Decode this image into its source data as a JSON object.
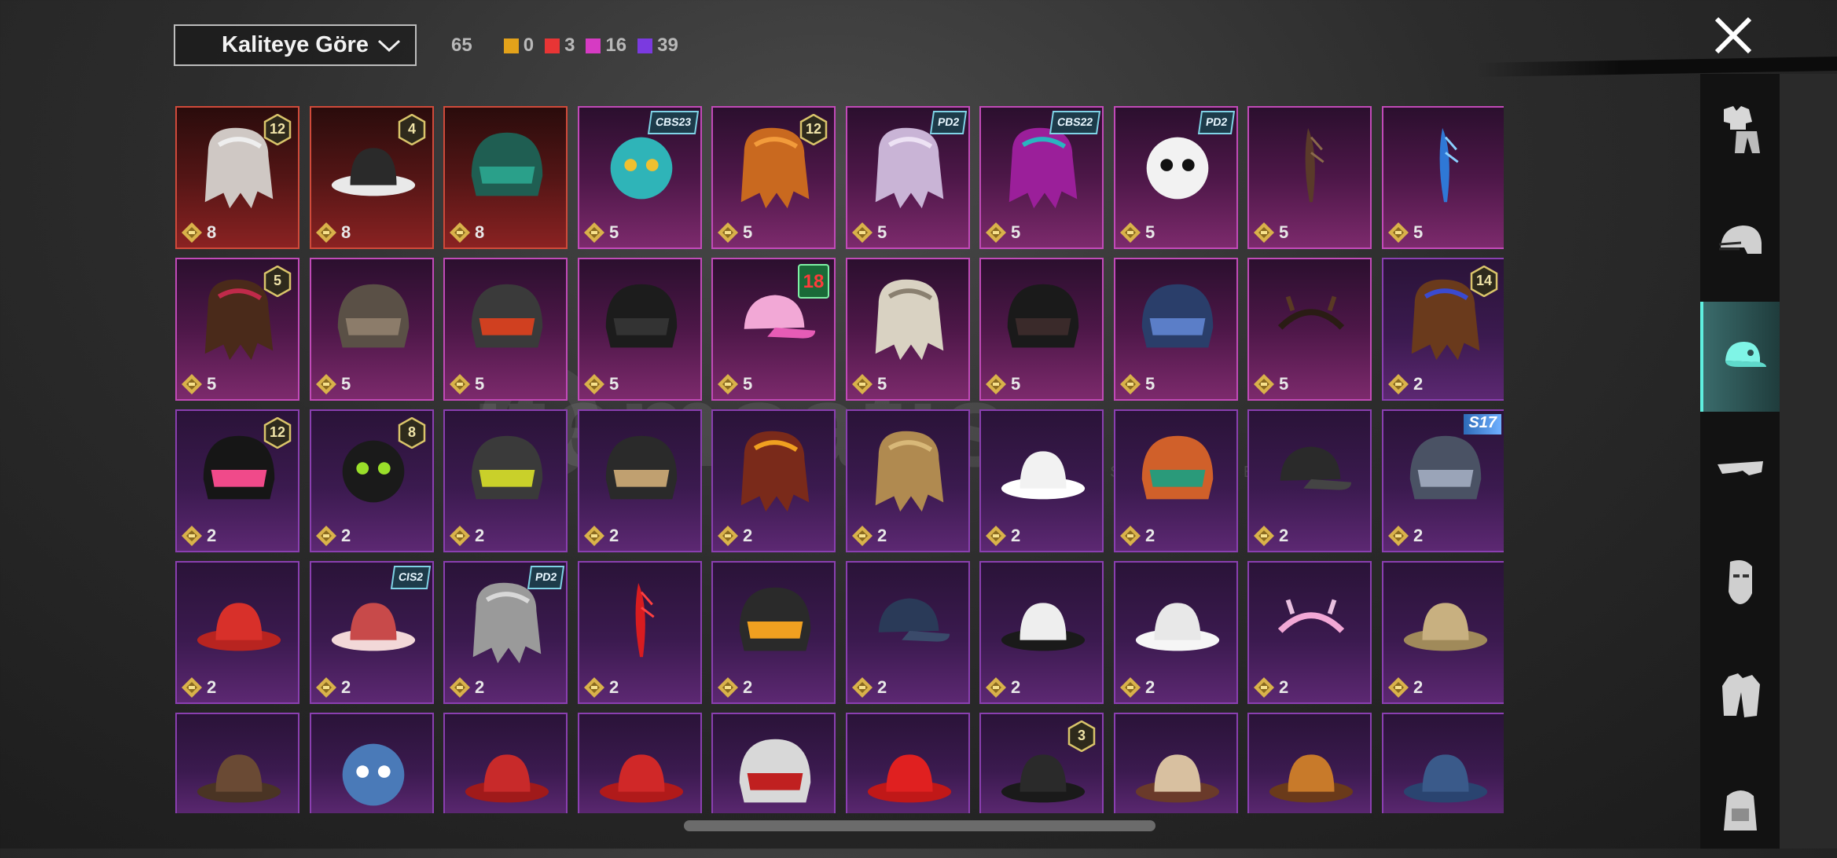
{
  "sort": {
    "label": "Kaliteye Göre"
  },
  "counts": {
    "total": "65",
    "items": [
      {
        "color": "#e3a21a",
        "value": "0"
      },
      {
        "color": "#e83535",
        "value": "3"
      },
      {
        "color": "#d63bc3",
        "value": "16"
      },
      {
        "color": "#7b3ae0",
        "value": "39"
      }
    ]
  },
  "watermark": {
    "text": "itemsatis",
    "sub": "/ SKIN / ITEM / E-PIN .com"
  },
  "categories": [
    {
      "icon": "outfit-icon"
    },
    {
      "icon": "helmet-icon"
    },
    {
      "icon": "cap-icon",
      "active": true
    },
    {
      "icon": "goggles-icon"
    },
    {
      "icon": "mask-icon"
    },
    {
      "icon": "jacket-icon"
    },
    {
      "icon": "backpack-icon"
    }
  ],
  "items": [
    {
      "rarity": "red",
      "price": "8",
      "badge": "12",
      "art": "white-wig"
    },
    {
      "rarity": "red",
      "price": "8",
      "badge": "4",
      "art": "snowman-tophat"
    },
    {
      "rarity": "red",
      "price": "8",
      "badge": "",
      "art": "dragon-helm"
    },
    {
      "rarity": "pink",
      "price": "5",
      "tag": "CBS23",
      "art": "cat-headphones"
    },
    {
      "rarity": "pink",
      "price": "5",
      "badge": "12",
      "art": "orange-hair"
    },
    {
      "rarity": "pink",
      "price": "5",
      "tag": "PD2",
      "art": "lilac-hair"
    },
    {
      "rarity": "pink",
      "price": "5",
      "tag": "CBS22",
      "art": "magenta-hair"
    },
    {
      "rarity": "pink",
      "price": "5",
      "tag": "PD2",
      "art": "panda-head"
    },
    {
      "rarity": "pink",
      "price": "5",
      "badge": "",
      "art": "feather"
    },
    {
      "rarity": "pink",
      "price": "5",
      "badge": "",
      "art": "blue-bird"
    },
    {
      "rarity": "pink",
      "price": "5",
      "badge": "5",
      "art": "bow-hair"
    },
    {
      "rarity": "pink",
      "price": "5",
      "badge": "",
      "art": "spiked-mask"
    },
    {
      "rarity": "pink",
      "price": "5",
      "badge": "",
      "art": "moto-helmet"
    },
    {
      "rarity": "pink",
      "price": "5",
      "badge": "",
      "art": "black-helmet"
    },
    {
      "rarity": "pink",
      "price": "5",
      "age": "18",
      "art": "pink-cap-headphones"
    },
    {
      "rarity": "pink",
      "price": "5",
      "badge": "",
      "art": "dreadlocks"
    },
    {
      "rarity": "pink",
      "price": "5",
      "badge": "",
      "art": "dark-hood"
    },
    {
      "rarity": "pink",
      "price": "5",
      "badge": "",
      "art": "blue-mech-helm"
    },
    {
      "rarity": "pink",
      "price": "5",
      "badge": "",
      "art": "headband"
    },
    {
      "rarity": "purple",
      "price": "2",
      "badge": "14",
      "art": "cat-hair"
    },
    {
      "rarity": "purple",
      "price": "2",
      "badge": "12",
      "art": "bunny-helmet"
    },
    {
      "rarity": "purple",
      "price": "2",
      "badge": "8",
      "art": "green-skull-hair"
    },
    {
      "rarity": "purple",
      "price": "2",
      "badge": "",
      "art": "gas-mask-helm"
    },
    {
      "rarity": "purple",
      "price": "2",
      "badge": "",
      "art": "visor-helmet"
    },
    {
      "rarity": "purple",
      "price": "2",
      "badge": "",
      "art": "goggles-hair"
    },
    {
      "rarity": "purple",
      "price": "2",
      "badge": "",
      "art": "blonde-hair"
    },
    {
      "rarity": "purple",
      "price": "2",
      "badge": "",
      "art": "sun-hat"
    },
    {
      "rarity": "purple",
      "price": "2",
      "badge": "",
      "art": "orange-helmet"
    },
    {
      "rarity": "purple",
      "price": "2",
      "badge": "",
      "art": "black-cap"
    },
    {
      "rarity": "purple",
      "price": "2",
      "season": "S17",
      "art": "horned-helm"
    },
    {
      "rarity": "purple",
      "price": "2",
      "badge": "",
      "art": "fez"
    },
    {
      "rarity": "purple",
      "price": "2",
      "tag": "CIS2",
      "art": "striped-beanie"
    },
    {
      "rarity": "purple",
      "price": "2",
      "tag": "PD2",
      "art": "grey-bob"
    },
    {
      "rarity": "purple",
      "price": "2",
      "badge": "",
      "art": "red-mohawk"
    },
    {
      "rarity": "purple",
      "price": "2",
      "badge": "",
      "art": "robot-mask"
    },
    {
      "rarity": "purple",
      "price": "2",
      "badge": "",
      "art": "navy-cap"
    },
    {
      "rarity": "purple",
      "price": "2",
      "badge": "",
      "art": "conical-hat"
    },
    {
      "rarity": "purple",
      "price": "2",
      "badge": "",
      "art": "white-beanie"
    },
    {
      "rarity": "purple",
      "price": "2",
      "badge": "",
      "art": "cat-ear-headphones"
    },
    {
      "rarity": "purple",
      "price": "2",
      "badge": "",
      "art": "straw-hat"
    },
    {
      "rarity": "purple",
      "price": "",
      "badge": "",
      "art": "cowboy-hat"
    },
    {
      "rarity": "purple",
      "price": "",
      "badge": "",
      "art": "shark-hat"
    },
    {
      "rarity": "purple",
      "price": "",
      "badge": "",
      "art": "red-beret"
    },
    {
      "rarity": "purple",
      "price": "",
      "badge": "",
      "art": "red-fedora"
    },
    {
      "rarity": "purple",
      "price": "",
      "badge": "",
      "art": "football-helmet"
    },
    {
      "rarity": "purple",
      "price": "",
      "badge": "",
      "art": "bucket-hat"
    },
    {
      "rarity": "purple",
      "price": "",
      "badge": "3",
      "art": "black-fedora"
    },
    {
      "rarity": "purple",
      "price": "",
      "badge": "",
      "art": "cake-hat"
    },
    {
      "rarity": "purple",
      "price": "",
      "badge": "",
      "art": "burger-hat"
    },
    {
      "rarity": "purple",
      "price": "",
      "badge": "",
      "art": "blue-cap"
    }
  ],
  "colors": {
    "red": "#c0392b",
    "pink": "#c14ab8",
    "purple": "#8a3fb0",
    "gold": "#d9b24a"
  }
}
